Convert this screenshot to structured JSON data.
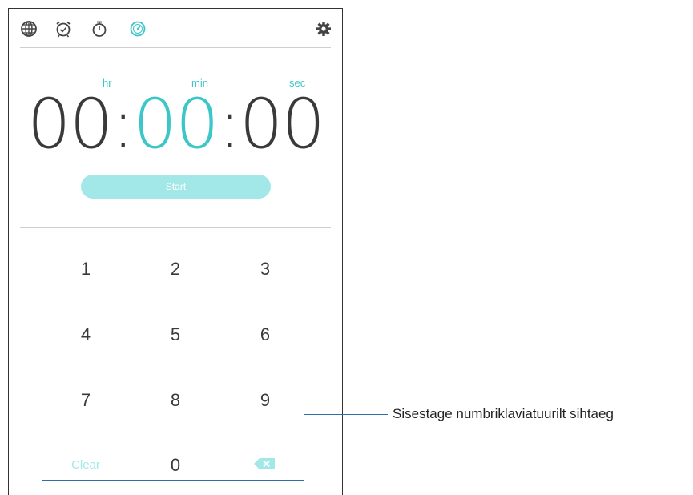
{
  "tabs": [
    {
      "icon": "globe-icon"
    },
    {
      "icon": "alarm-icon"
    },
    {
      "icon": "stopwatch-icon"
    },
    {
      "icon": "timer-icon",
      "active": true
    },
    {
      "icon": "settings-gear-icon"
    }
  ],
  "timer": {
    "units": {
      "hr": "hr",
      "min": "min",
      "sec": "sec"
    },
    "hours": "00",
    "minutes": "00",
    "seconds": "00",
    "separator": ":",
    "start_label": "Start"
  },
  "keypad": {
    "keys": [
      "1",
      "2",
      "3",
      "4",
      "5",
      "6",
      "7",
      "8",
      "9"
    ],
    "clear_label": "Clear",
    "zero": "0",
    "backspace_icon": "backspace-icon"
  },
  "callout": {
    "text": "Sisestage numbriklaviatuurilt sihtaeg"
  },
  "colors": {
    "accent": "#3cc6c8",
    "accent_light": "#a3e8e8",
    "text": "#3a3a3a",
    "callout_line": "#2f6ea8"
  }
}
